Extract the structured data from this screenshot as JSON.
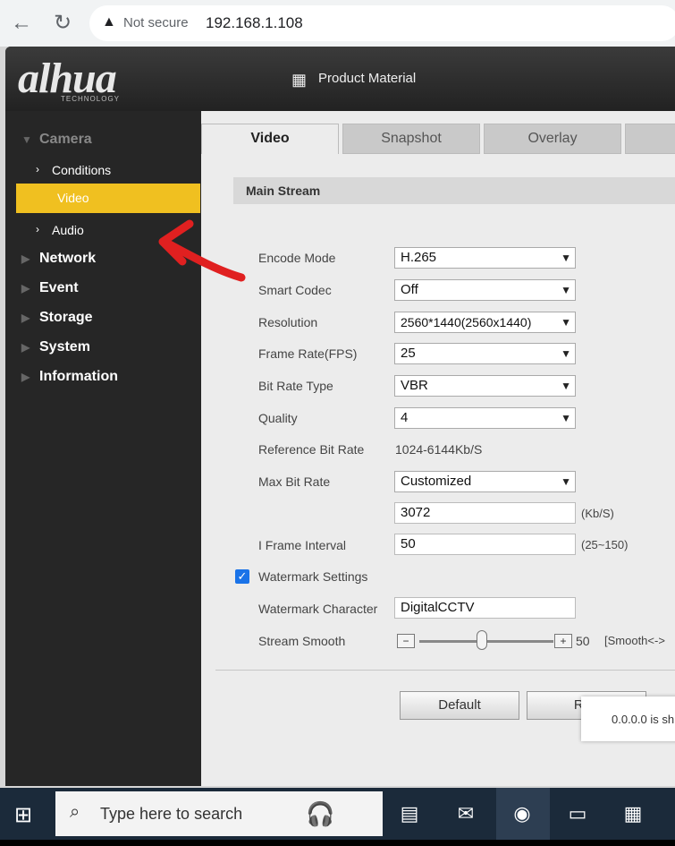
{
  "browser": {
    "back_icon": "arrow-left-icon",
    "reload_icon": "reload-icon",
    "security_label": "Not secure",
    "url": "192.168.1.108"
  },
  "header": {
    "logo": "alhua",
    "logo_sub": "TECHNOLOGY",
    "product_label": "Product Material"
  },
  "sidebar": {
    "camera": "Camera",
    "conditions": "Conditions",
    "video": "Video",
    "audio": "Audio",
    "network": "Network",
    "event": "Event",
    "storage": "Storage",
    "system": "System",
    "information": "Information"
  },
  "tabs": [
    "Video",
    "Snapshot",
    "Overlay"
  ],
  "section_title": "Main Stream",
  "form": {
    "encode_mode": {
      "label": "Encode Mode",
      "value": "H.265"
    },
    "smart_codec": {
      "label": "Smart Codec",
      "value": "Off"
    },
    "resolution": {
      "label": "Resolution",
      "value": "2560*1440(2560x1440)"
    },
    "frame_rate": {
      "label": "Frame Rate(FPS)",
      "value": "25"
    },
    "bit_rate_type": {
      "label": "Bit Rate Type",
      "value": "VBR"
    },
    "quality": {
      "label": "Quality",
      "value": "4"
    },
    "reference_bit_rate": {
      "label": "Reference Bit Rate",
      "value": "1024-6144Kb/S"
    },
    "max_bit_rate": {
      "label": "Max Bit Rate",
      "value": "Customized"
    },
    "custom_bit_rate": {
      "value": "3072",
      "unit": "(Kb/S)"
    },
    "i_frame_interval": {
      "label": "I Frame Interval",
      "value": "50",
      "unit": "(25~150)"
    },
    "watermark_settings": {
      "label": "Watermark Settings",
      "checked": true
    },
    "watermark_character": {
      "label": "Watermark Character",
      "value": "DigitalCCTV"
    },
    "stream_smooth": {
      "label": "Stream Smooth",
      "value": "50",
      "hint": "[Smooth<->"
    }
  },
  "buttons": {
    "default": "Default",
    "refresh": "Refr"
  },
  "toast": "0.0.0.0 is sh",
  "taskbar": {
    "search_placeholder": "Type here to search"
  }
}
